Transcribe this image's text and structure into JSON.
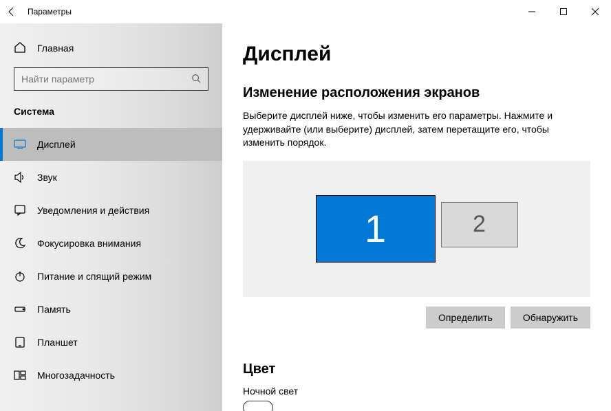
{
  "titlebar": {
    "title": "Параметры"
  },
  "sidebar": {
    "home_label": "Главная",
    "search_placeholder": "Найти параметр",
    "category_label": "Система",
    "items": [
      {
        "label": "Дисплей"
      },
      {
        "label": "Звук"
      },
      {
        "label": "Уведомления и действия"
      },
      {
        "label": "Фокусировка внимания"
      },
      {
        "label": "Питание и спящий режим"
      },
      {
        "label": "Память"
      },
      {
        "label": "Планшет"
      },
      {
        "label": "Многозадачность"
      }
    ]
  },
  "main": {
    "heading": "Дисплей",
    "rearrange_heading": "Изменение расположения экранов",
    "rearrange_desc": "Выберите дисплей ниже, чтобы изменить его параметры. Нажмите и удерживайте (или выберите) дисплей, затем перетащите его, чтобы изменить порядок.",
    "screen1": "1",
    "screen2": "2",
    "identify_btn": "Определить",
    "detect_btn": "Обнаружить",
    "color_heading": "Цвет",
    "nightlight_label": "Ночной свет"
  }
}
